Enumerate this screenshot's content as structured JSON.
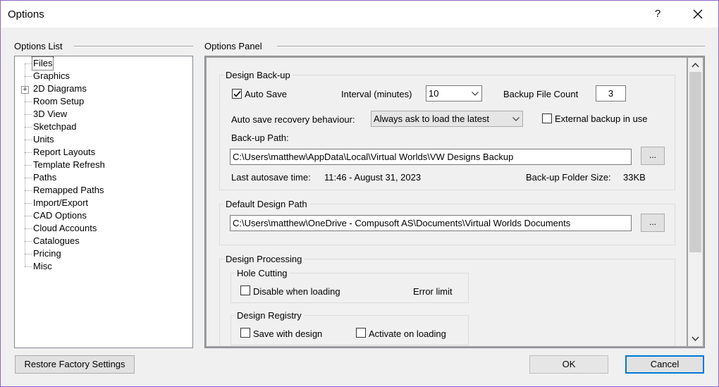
{
  "window": {
    "title": "Options",
    "help_label": "?"
  },
  "options_list": {
    "label": "Options List",
    "items": [
      {
        "label": "Files"
      },
      {
        "label": "Graphics"
      },
      {
        "label": "2D Diagrams"
      },
      {
        "label": "Room Setup"
      },
      {
        "label": "3D View"
      },
      {
        "label": "Sketchpad"
      },
      {
        "label": "Units"
      },
      {
        "label": "Report Layouts"
      },
      {
        "label": "Template Refresh"
      },
      {
        "label": "Paths"
      },
      {
        "label": "Remapped Paths"
      },
      {
        "label": "Import/Export"
      },
      {
        "label": "CAD Options"
      },
      {
        "label": "Cloud Accounts"
      },
      {
        "label": "Catalogues"
      },
      {
        "label": "Pricing"
      },
      {
        "label": "Misc"
      }
    ],
    "selected": "Files"
  },
  "options_panel": {
    "label": "Options Panel",
    "backup": {
      "legend": "Design Back-up",
      "auto_save_label": "Auto Save",
      "auto_save_checked": true,
      "interval_label": "Interval (minutes)",
      "interval_value": "10",
      "backup_count_label": "Backup File Count",
      "backup_count_value": "3",
      "recovery_label": "Auto save recovery behaviour:",
      "recovery_value": "Always ask to load the latest",
      "external_backup_label": "External backup in use",
      "external_backup_checked": false,
      "path_label": "Back-up Path:",
      "path_value": "C:\\Users\\matthew\\AppData\\Local\\Virtual Worlds\\VW Designs Backup",
      "browse_label": "...",
      "last_autosave_label": "Last autosave time:",
      "last_autosave_value": "11:46 - August 31, 2023",
      "folder_size_label": "Back-up Folder Size:",
      "folder_size_value": "33KB"
    },
    "default_path": {
      "legend": "Default Design Path",
      "path_value": "C:\\Users\\matthew\\OneDrive - Compusoft AS\\Documents\\Virtual Worlds Documents",
      "browse_label": "..."
    },
    "processing": {
      "legend": "Design Processing",
      "hole_cutting": {
        "legend": "Hole Cutting",
        "disable_label": "Disable when loading",
        "disable_checked": false,
        "error_limit_label": "Error limit"
      },
      "registry": {
        "legend": "Design Registry",
        "save_label": "Save with design",
        "save_checked": false,
        "activate_label": "Activate on loading",
        "activate_checked": false
      }
    }
  },
  "buttons": {
    "restore_label": "Restore Factory Settings",
    "ok_label": "OK",
    "cancel_label": "Cancel"
  }
}
